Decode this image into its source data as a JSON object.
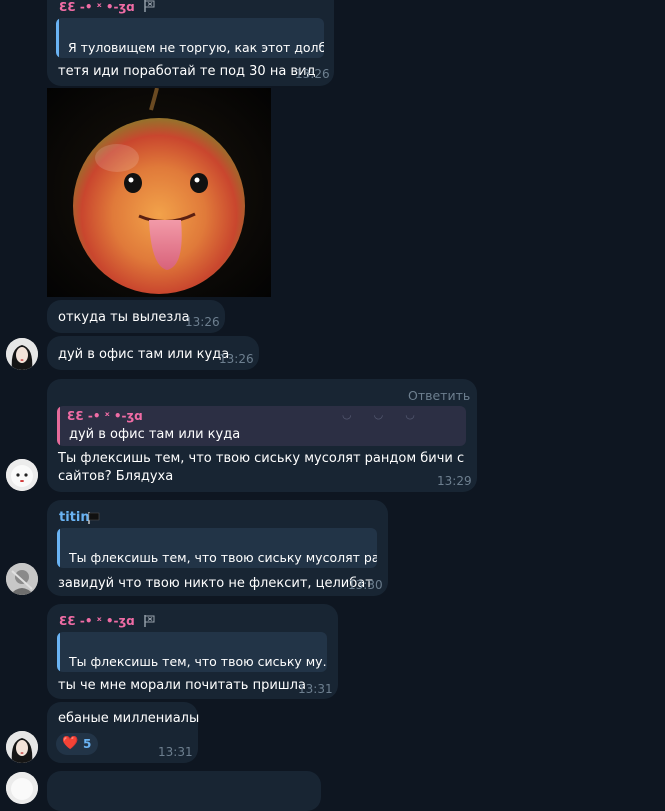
{
  "colors": {
    "background": "#0e1621",
    "bubble": "#182533",
    "quote_blue": "#6ab3f3",
    "quote_pink": "#e56b9a",
    "sender_blue": "#6ab3f3",
    "sender_pink": "#f06ca5",
    "time": "#6d7f8f",
    "reply_link": "#6d7f8f"
  },
  "messages": [
    {
      "sender": "ƐƐ -• ˣ •-ʒɑ",
      "sender_emoji": "pirate-flag-icon",
      "quote": "Я туловищем не торгую, как этот долб...",
      "text": "тетя иди поработай те под 30 на вид",
      "time": "13:26"
    },
    {
      "image": "apple-with-tongue-photo",
      "text": "откуда ты вылезла",
      "time": "13:26"
    },
    {
      "text": "дуй в офис там или куда",
      "time": "13:26"
    },
    {
      "reply_label": "Ответить",
      "quote_sender": "ƐƐ -• ˣ •-ʒɑ",
      "quote": "дуй в офис там или куда",
      "text_line1": "Ты флексишь тем, что твою сиську мусолят рандом бичи с",
      "text_line2": "сайтов? Блядуха",
      "time": "13:29"
    },
    {
      "sender": "titin",
      "sender_emoji": "black-flag-icon",
      "quote": "Ты флексишь тем, что твою сиську мусолят ра...",
      "text": "завидуй что твою никто не флексит, целибат",
      "time": "13:30"
    },
    {
      "sender": "ƐƐ -• ˣ •-ʒɑ",
      "sender_emoji": "pirate-flag-icon",
      "quote": "Ты флексишь тем, что твою сиську му...",
      "text": "ты че мне морали почитать пришла",
      "time": "13:31"
    },
    {
      "text": "ебаные миллениалы",
      "reaction_emoji": "❤️",
      "reaction_count": "5",
      "time": "13:31"
    }
  ]
}
